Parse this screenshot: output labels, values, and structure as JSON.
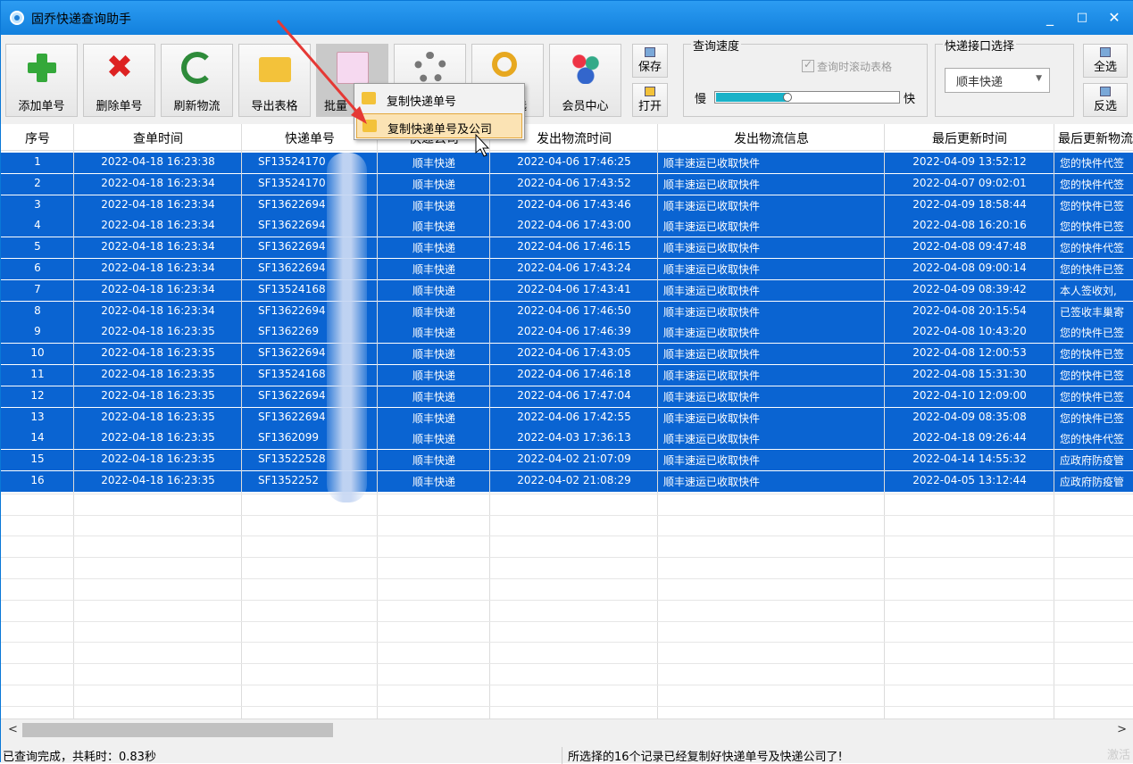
{
  "window": {
    "title": "固乔快递查询助手",
    "minimize": "_",
    "maximize": "□",
    "close": "✕"
  },
  "toolbar": {
    "buttons": [
      {
        "label": "添加单号",
        "icon": "add-icon"
      },
      {
        "label": "删除单号",
        "icon": "delete-icon"
      },
      {
        "label": "刷新物流",
        "icon": "refresh-icon"
      },
      {
        "label": "导出表格",
        "icon": "export-folder-icon"
      },
      {
        "label": "批量",
        "icon": "batch-document-icon"
      },
      {
        "label": "",
        "icon": "settings-gear-icon"
      },
      {
        "label": "选",
        "icon": "filter-search-icon"
      },
      {
        "label": "会员中心",
        "icon": "member-center-icon"
      }
    ],
    "save": "保存",
    "open": "打开",
    "select_all": "全选",
    "invert": "反选",
    "speed": {
      "title": "查询速度",
      "scroll_checkbox": "查询时滚动表格",
      "slow": "慢",
      "fast": "快",
      "level": 0.4
    },
    "api": {
      "title": "快递接口选择",
      "selected": "顺丰快递"
    }
  },
  "context_menu": {
    "items": [
      "复制快递单号",
      "复制快递单号及公司"
    ],
    "highlighted": 1
  },
  "table": {
    "columns": [
      "序号",
      "查单时间",
      "快递单号",
      "快递公司",
      "发出物流时间",
      "发出物流信息",
      "最后更新时间",
      "最后更新物流"
    ],
    "rows": [
      [
        "1",
        "2022-04-18 16:23:38",
        "SF13524170",
        "顺丰快递",
        "2022-04-06 17:46:25",
        "顺丰速运已收取快件",
        "2022-04-09 13:52:12",
        "您的快件代签"
      ],
      [
        "2",
        "2022-04-18 16:23:34",
        "SF13524170",
        "顺丰快递",
        "2022-04-06 17:43:52",
        "顺丰速运已收取快件",
        "2022-04-07 09:02:01",
        "您的快件代签"
      ],
      [
        "3",
        "2022-04-18 16:23:34",
        "SF13622694",
        "顺丰快递",
        "2022-04-06 17:43:46",
        "顺丰速运已收取快件",
        "2022-04-09 18:58:44",
        "您的快件已签"
      ],
      [
        "4",
        "2022-04-18 16:23:34",
        "SF13622694",
        "顺丰快递",
        "2022-04-06 17:43:00",
        "顺丰速运已收取快件",
        "2022-04-08 16:20:16",
        "您的快件已签"
      ],
      [
        "5",
        "2022-04-18 16:23:34",
        "SF13622694",
        "顺丰快递",
        "2022-04-06 17:46:15",
        "顺丰速运已收取快件",
        "2022-04-08 09:47:48",
        "您的快件代签"
      ],
      [
        "6",
        "2022-04-18 16:23:34",
        "SF13622694",
        "顺丰快递",
        "2022-04-06 17:43:24",
        "顺丰速运已收取快件",
        "2022-04-08 09:00:14",
        "您的快件已签"
      ],
      [
        "7",
        "2022-04-18 16:23:34",
        "SF13524168",
        "顺丰快递",
        "2022-04-06 17:43:41",
        "顺丰速运已收取快件",
        "2022-04-09 08:39:42",
        "本人签收刘,"
      ],
      [
        "8",
        "2022-04-18 16:23:34",
        "SF13622694",
        "顺丰快递",
        "2022-04-06 17:46:50",
        "顺丰速运已收取快件",
        "2022-04-08 20:15:54",
        "已签收丰巢寄"
      ],
      [
        "9",
        "2022-04-18 16:23:35",
        "SF1362269",
        "顺丰快递",
        "2022-04-06 17:46:39",
        "顺丰速运已收取快件",
        "2022-04-08 10:43:20",
        "您的快件已签"
      ],
      [
        "10",
        "2022-04-18 16:23:35",
        "SF13622694",
        "顺丰快递",
        "2022-04-06 17:43:05",
        "顺丰速运已收取快件",
        "2022-04-08 12:00:53",
        "您的快件已签"
      ],
      [
        "11",
        "2022-04-18 16:23:35",
        "SF13524168",
        "顺丰快递",
        "2022-04-06 17:46:18",
        "顺丰速运已收取快件",
        "2022-04-08 15:31:30",
        "您的快件已签"
      ],
      [
        "12",
        "2022-04-18 16:23:35",
        "SF13622694",
        "顺丰快递",
        "2022-04-06 17:47:04",
        "顺丰速运已收取快件",
        "2022-04-10 12:09:00",
        "您的快件已签"
      ],
      [
        "13",
        "2022-04-18 16:23:35",
        "SF13622694",
        "顺丰快递",
        "2022-04-06 17:42:55",
        "顺丰速运已收取快件",
        "2022-04-09 08:35:08",
        "您的快件已签"
      ],
      [
        "14",
        "2022-04-18 16:23:35",
        "SF1362099",
        "顺丰快递",
        "2022-04-03 17:36:13",
        "顺丰速运已收取快件",
        "2022-04-18 09:26:44",
        "您的快件代签"
      ],
      [
        "15",
        "2022-04-18 16:23:35",
        "SF13522528",
        "顺丰快递",
        "2022-04-02 21:07:09",
        "顺丰速运已收取快件",
        "2022-04-14 14:55:32",
        "应政府防疫管"
      ],
      [
        "16",
        "2022-04-18 16:23:35",
        "SF1352252",
        "顺丰快递",
        "2022-04-02 21:08:29",
        "顺丰速运已收取快件",
        "2022-04-05 13:12:44",
        "应政府防疫管"
      ]
    ]
  },
  "scroll": {
    "left": "<",
    "right": ">"
  },
  "status": {
    "left": "已查询完成，共耗时：0.83秒",
    "center": "所选择的16个记录已经复制好快递单号及快递公司了!",
    "right": "激活"
  },
  "colors": {
    "title_bar": "#1e90ff",
    "selection": "#0a64d2",
    "arrow": "#e53935"
  }
}
